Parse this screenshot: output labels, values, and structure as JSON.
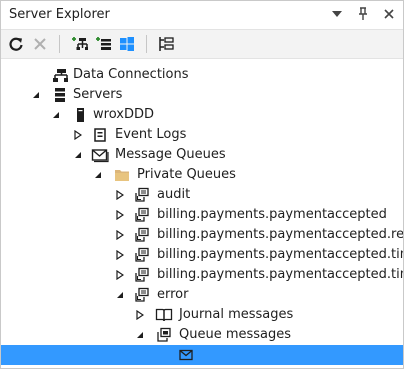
{
  "window": {
    "title": "Server Explorer",
    "dropdown_icon": "chevron-down-icon",
    "pin_icon": "pin-icon",
    "close_icon": "close-icon"
  },
  "toolbar": {
    "refresh_icon": "refresh-icon",
    "stop_icon": "stop-icon",
    "connect_database_icon": "connect-database-icon",
    "connect_server_icon": "connect-server-icon",
    "connect_azure_icon": "windows-azure-icon",
    "properties_icon": "properties-icon"
  },
  "tree": {
    "data_connections": "Data Connections",
    "servers": "Servers",
    "server_name": "wroxDDD",
    "event_logs": "Event Logs",
    "message_queues": "Message Queues",
    "private_queues": "Private Queues",
    "queues": [
      "audit",
      "billing.payments.paymentaccepted",
      "billing.payments.paymentaccepted.retries",
      "billing.payments.paymentaccepted.timeouts",
      "billing.payments.paymentaccepted.timeoutsdispatcher"
    ],
    "error_queue": "error",
    "journal_messages": "Journal messages",
    "queue_messages": "Queue messages"
  },
  "colors": {
    "selection": "#3399ff",
    "folder": "#dcb67a"
  }
}
